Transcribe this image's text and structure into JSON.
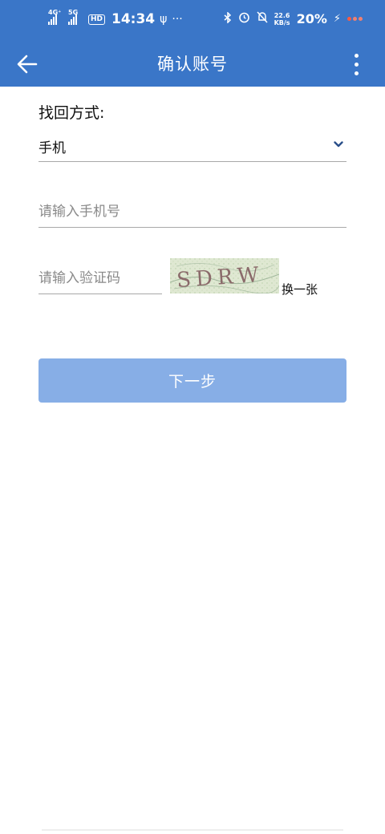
{
  "status_bar": {
    "network1": "4G⁺",
    "network2": "5G",
    "hd": "HD",
    "time": "14:34",
    "usb": "ψ",
    "more": "···",
    "net_speed_value": "22.6",
    "net_speed_unit": "KB/s",
    "battery": "20%"
  },
  "header": {
    "title": "确认账号"
  },
  "form": {
    "method_label": "找回方式:",
    "method_value": "手机",
    "phone_placeholder": "请输入手机号",
    "code_placeholder": "请输入验证码",
    "captcha_text": "SDRW",
    "refresh_label": "换一张",
    "next_label": "下一步"
  },
  "colors": {
    "primary": "#3a76c8",
    "button_disabled": "#87aee6",
    "chevron": "#2a4f8a"
  }
}
